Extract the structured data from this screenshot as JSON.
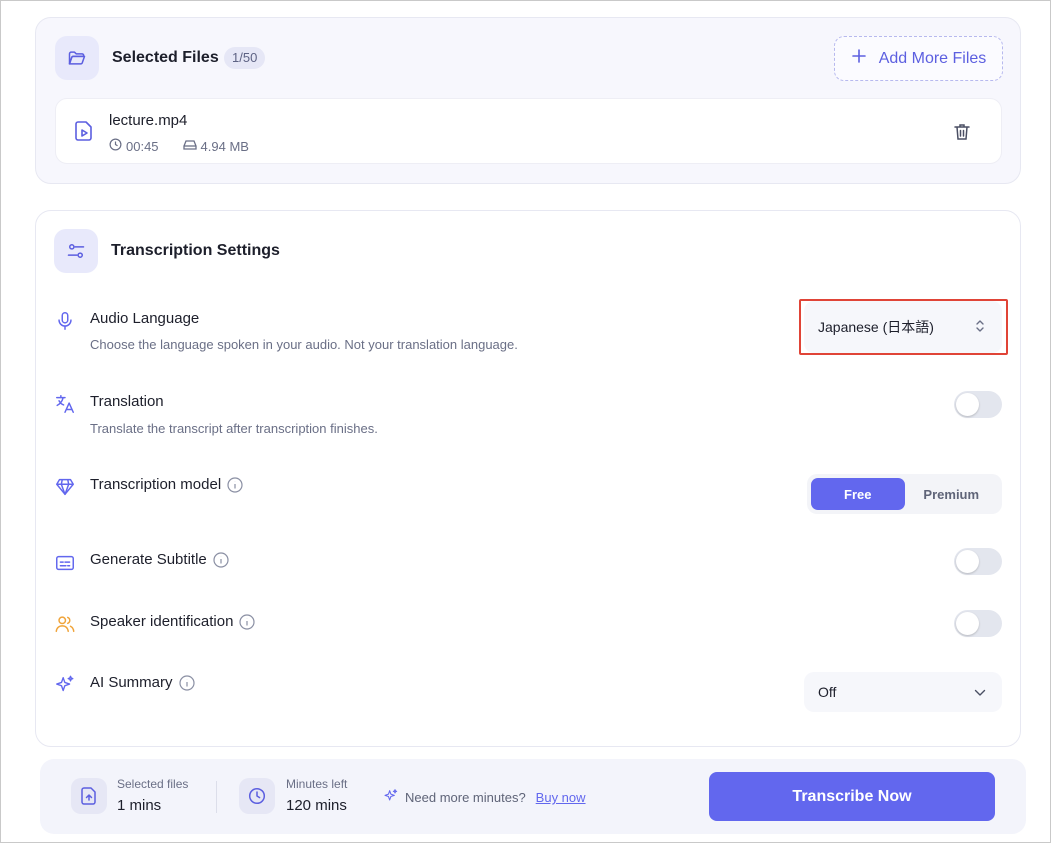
{
  "files_section": {
    "title": "Selected Files",
    "count": "1/50",
    "add_more_label": "Add More Files",
    "files": [
      {
        "name": "lecture.mp4",
        "duration": "00:45",
        "size": "4.94 MB"
      }
    ]
  },
  "settings": {
    "title": "Transcription Settings",
    "audio_language": {
      "label": "Audio Language",
      "description": "Choose the language spoken in your audio. Not your translation language.",
      "value": "Japanese (日本語)"
    },
    "translation": {
      "label": "Translation",
      "description": "Translate the transcript after transcription finishes.",
      "enabled": false
    },
    "model": {
      "label": "Transcription model",
      "options": [
        "Free",
        "Premium"
      ],
      "selected": "Free"
    },
    "subtitle": {
      "label": "Generate Subtitle",
      "enabled": false
    },
    "speaker": {
      "label": "Speaker identification",
      "enabled": false
    },
    "ai_summary": {
      "label": "AI Summary",
      "value": "Off"
    }
  },
  "footer": {
    "selected_files_label": "Selected files",
    "selected_files_value": "1 mins",
    "minutes_left_label": "Minutes left",
    "minutes_left_value": "120 mins",
    "need_more_text": "Need more minutes?",
    "buy_now_label": "Buy now",
    "transcribe_label": "Transcribe Now"
  },
  "colors": {
    "accent": "#6267ee",
    "highlight": "#e04437",
    "speaker_icon": "#f0a43a"
  }
}
